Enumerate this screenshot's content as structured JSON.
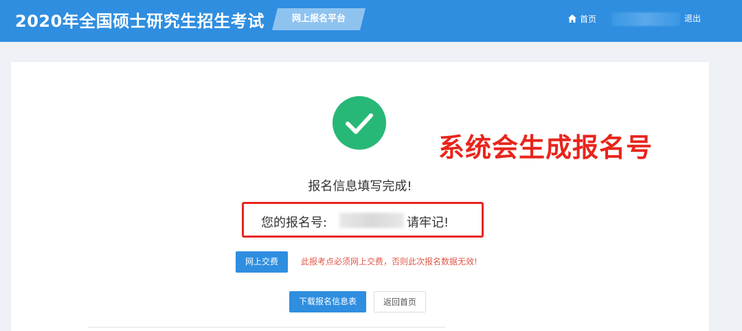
{
  "header": {
    "site_title": "2020年全国硕士研究生招生考试",
    "platform_label": "网上报名平台",
    "home_link": "首页",
    "logout_link": "退出"
  },
  "result": {
    "done_message": "报名信息填写完成!",
    "registration_label": "您的报名号:",
    "registration_suffix": "请牢记!"
  },
  "payment": {
    "pay_button": "网上交费",
    "warning": "此报考点必须网上交费，否则此次报名数据无效!"
  },
  "actions": {
    "download_button": "下载报名信息表",
    "home_button": "返回首页"
  },
  "annotation": {
    "text": "系统会生成报名号"
  },
  "colors": {
    "header_bg": "#2f8ee0",
    "success_green": "#27b877",
    "annotation_red": "#e8251c",
    "warning_red": "#e0584a"
  },
  "icons": {
    "home": "home-icon",
    "success": "check-circle-icon"
  }
}
